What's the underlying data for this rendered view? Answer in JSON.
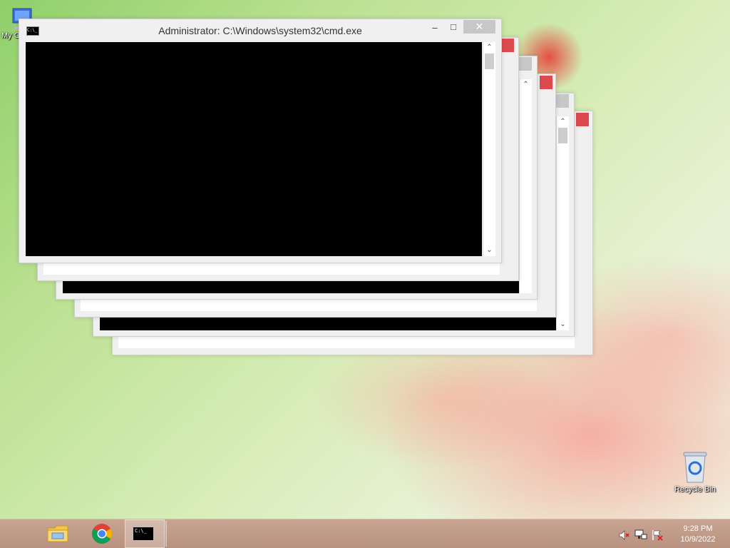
{
  "desktop": {
    "icons": [
      {
        "label": "My C"
      },
      {
        "label": "Recycle Bin"
      }
    ]
  },
  "window": {
    "title": "Administrator: C:\\Windows\\system32\\cmd.exe",
    "minimize_glyph": "–",
    "maximize_glyph": "□",
    "close_glyph": "✕",
    "console_icon_text": "C:\\_"
  },
  "taskbar": {
    "apps": [
      {
        "name": "File Explorer"
      },
      {
        "name": "Google Chrome"
      },
      {
        "name": "Command Prompt",
        "active": true
      }
    ]
  },
  "tray": {
    "time": "9:28 PM",
    "date": "10/9/2022"
  }
}
